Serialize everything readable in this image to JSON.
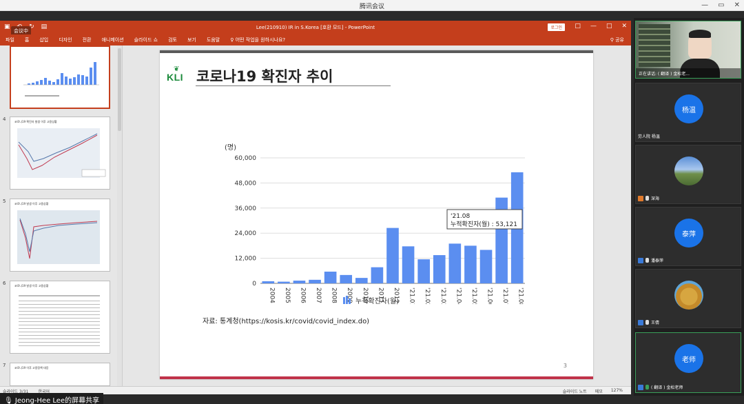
{
  "window": {
    "title": "腾讯会议",
    "controls": [
      "—",
      "▭",
      "✕"
    ]
  },
  "ppt": {
    "doc_title": "Lee(210910) IR in S.Korea [호환 모드] - PowerPoint",
    "meeting_badge": "会议中",
    "signin": "로그인",
    "window_controls": [
      "□",
      "—",
      "□",
      "✕"
    ],
    "ribbon_tabs": [
      "파일",
      "홈",
      "삽입",
      "디자인",
      "전환",
      "애니메이션",
      "슬라이드 쇼",
      "검토",
      "보기",
      "도움말",
      "어떤 작업을 원하시나요?"
    ],
    "share": "공유",
    "thumbnails": [
      {
        "num": "",
        "title": ""
      },
      {
        "num": "4",
        "title": "코로나19 확진자 발생 이후 고용상황"
      },
      {
        "num": "5",
        "title": "코로나19 발생 이후 고용상황"
      },
      {
        "num": "6",
        "title": "코로나19 발생 이후 고용상황"
      },
      {
        "num": "7",
        "title": "코로나19 이후 고용정책 대응"
      }
    ],
    "status": {
      "slide": "슬라이드 3/31",
      "lang": "한국어",
      "notes": "슬라이드 노트",
      "comments": "메모",
      "zoom": "127%"
    }
  },
  "slide": {
    "logo": "KLI",
    "title": "코로나19 확진자 추이",
    "source": "자료: 통계청(https://kosis.kr/covid/covid_index.do)",
    "page": "3"
  },
  "chart_data": {
    "type": "bar",
    "unit_label": "(명)",
    "categories": [
      "2004",
      "2005",
      "2006",
      "2007",
      "2008",
      "2009",
      "2010",
      "2011",
      "2012",
      "'21.01",
      "'21.02",
      "'21.03",
      "'21.04",
      "'21.05",
      "'21.06",
      "'21.07",
      "'21.08"
    ],
    "series": [
      {
        "name": "누적확진자(월)",
        "values": [
          1000,
          800,
          1300,
          1700,
          5600,
          4000,
          2600,
          7700,
          26500,
          17700,
          11500,
          13500,
          19000,
          18000,
          16000,
          41000,
          53121
        ]
      }
    ],
    "ylim": [
      0,
      60000
    ],
    "yticks": [
      "0",
      "12,000",
      "24,000",
      "36,000",
      "48,000",
      "60,000"
    ],
    "tooltip": {
      "line1": "'21.08",
      "line2": "누적확진자(월) : 53,121"
    },
    "legend_position": "bottom",
    "bar_color": "#5b8ef0"
  },
  "participants": {
    "speaking": "正在讲话: ( 翻译 ) 金松老...",
    "tiles": [
      {
        "name": "(翻译) 金松老...",
        "avatar": ""
      },
      {
        "name": "劳人院 杨温",
        "avatar": "杨温"
      },
      {
        "name": "深海",
        "avatar": ""
      },
      {
        "name": "潘泰萍",
        "avatar": "泰萍"
      },
      {
        "name": "王倩",
        "avatar": ""
      },
      {
        "name": "( 翻译 ) 金松老师",
        "avatar": "老师"
      }
    ]
  },
  "share_label": "Jeong-Hee Lee的屏幕共享"
}
